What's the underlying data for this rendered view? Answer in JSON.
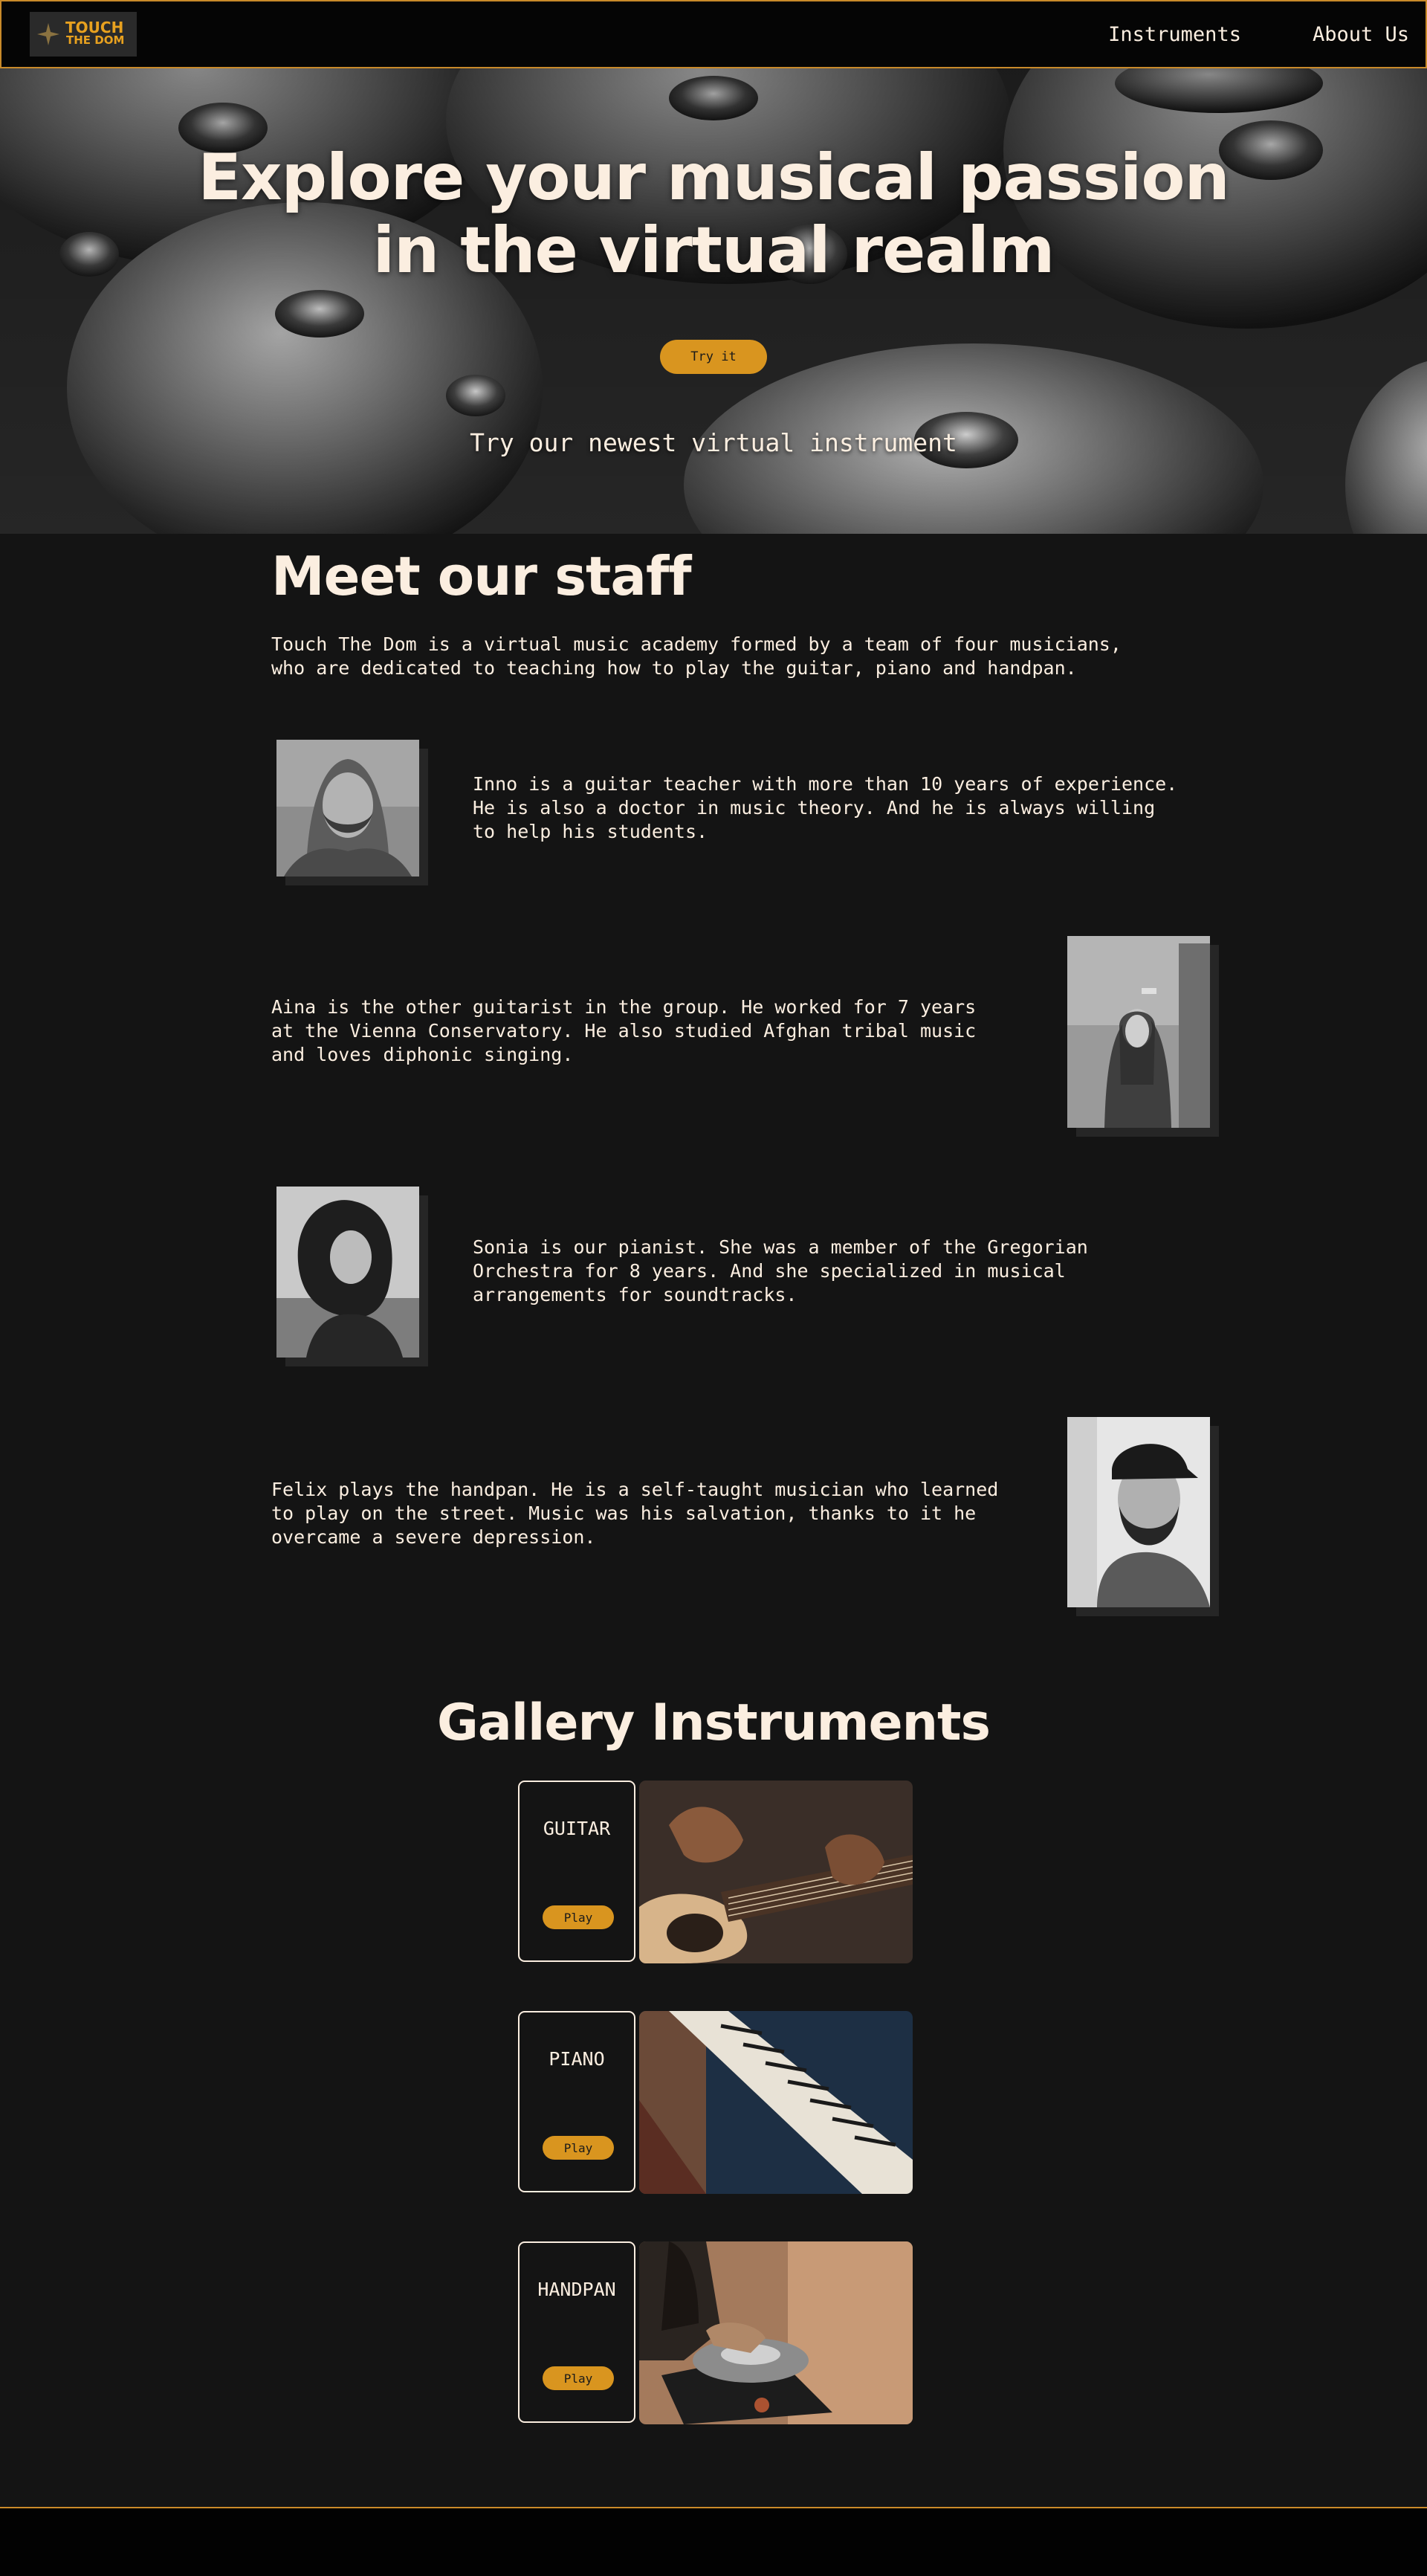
{
  "nav": {
    "logo_line1": "TOUCH",
    "logo_line2": "THE DOM",
    "links": [
      "Instruments",
      "About Us"
    ]
  },
  "hero": {
    "title_line1": "Explore your musical passion",
    "title_line2": "in the virtual realm",
    "button_label": "Try it",
    "subtitle": "Try our newest virtual instrument"
  },
  "staff": {
    "title": "Meet our staff",
    "intro": "Touch The Dom is a virtual music academy formed by a team of four musicians, who are dedicated to teaching how to play the guitar, piano and handpan.",
    "members": [
      {
        "text": "Inno is a guitar teacher with more than 10 years of experience. He is also a doctor in music theory. And he is always willing to help his students."
      },
      {
        "text": "Aina is the other guitarist in the group. He worked for 7 years at the Vienna Conservatory. He also studied Afghan tribal music and loves diphonic singing."
      },
      {
        "text": "Sonia is our pianist. She was a member of the Gregorian Orchestra for 8 years. And she specialized in musical arrangements for soundtracks."
      },
      {
        "text": "Felix plays the handpan. He is a self-taught musician who learned to play on the street. Music was his salvation, thanks to it he overcame a severe depression."
      }
    ]
  },
  "gallery": {
    "title": "Gallery Instruments",
    "items": [
      {
        "name": "GUITAR",
        "button": "Play"
      },
      {
        "name": "PIANO",
        "button": "Play"
      },
      {
        "name": "HANDPAN",
        "button": "Play"
      }
    ]
  },
  "colors": {
    "accent": "#d9951f",
    "border": "#c98a2a",
    "background": "#141414",
    "text": "#fbeee0"
  }
}
